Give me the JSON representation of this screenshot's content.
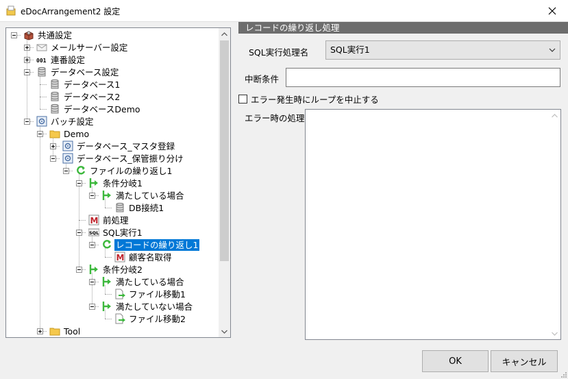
{
  "window": {
    "title": "eDocArrangement2 設定",
    "colors": {
      "selection": "#0078d7",
      "header_bg": "#6d6d6d",
      "green_arrow": "#3cb83c",
      "red_icon": "#c0262e"
    }
  },
  "tree": {
    "items": [
      {
        "label": "共通設定",
        "icon": "settings-package-icon"
      },
      {
        "label": "メールサーバー設定",
        "icon": "envelope-icon"
      },
      {
        "label": "連番設定",
        "icon": "number-001-icon"
      },
      {
        "label": "データベース設定",
        "icon": "database-icon"
      },
      {
        "label": "データベース1",
        "icon": "database-icon"
      },
      {
        "label": "データベース2",
        "icon": "database-icon"
      },
      {
        "label": "データベースDemo",
        "icon": "database-icon"
      },
      {
        "label": "バッチ設定",
        "icon": "batch-gear-icon"
      },
      {
        "label": "Demo",
        "icon": "folder-icon"
      },
      {
        "label": "データベース_マスタ登録",
        "icon": "batch-gear-icon"
      },
      {
        "label": "データベース_保管振り分け",
        "icon": "batch-gear-icon"
      },
      {
        "label": "ファイルの繰り返し1",
        "icon": "loop-icon"
      },
      {
        "label": "条件分岐1",
        "icon": "branch-arrow-icon"
      },
      {
        "label": "満たしている場合",
        "icon": "branch-arrow-icon"
      },
      {
        "label": "DB接続1",
        "icon": "database-icon"
      },
      {
        "label": "前処理",
        "icon": "macro-m-icon"
      },
      {
        "label": "SQL実行1",
        "icon": "sql-icon"
      },
      {
        "label": "レコードの繰り返し1",
        "icon": "loop-icon"
      },
      {
        "label": "顧客名取得",
        "icon": "macro-m-icon"
      },
      {
        "label": "条件分岐2",
        "icon": "branch-arrow-icon"
      },
      {
        "label": "満たしている場合",
        "icon": "branch-arrow-icon"
      },
      {
        "label": "ファイル移動1",
        "icon": "file-move-icon"
      },
      {
        "label": "満たしていない場合",
        "icon": "branch-arrow-icon"
      },
      {
        "label": "ファイル移動2",
        "icon": "file-move-icon"
      },
      {
        "label": "Tool",
        "icon": "folder-icon"
      }
    ],
    "selected_label": "レコードの繰り返し1"
  },
  "panel": {
    "header": "レコードの繰り返し処理",
    "sql_label": "SQL実行処理名",
    "sql_value": "SQL実行1",
    "interrupt_label": "中断条件",
    "interrupt_value": "",
    "stop_on_error_label": "エラー発生時にループを中止する",
    "stop_on_error_checked": false,
    "error_handling_label": "エラー時の処理",
    "error_handling_value": ""
  },
  "buttons": {
    "ok": "OK",
    "cancel": "キャンセル"
  }
}
